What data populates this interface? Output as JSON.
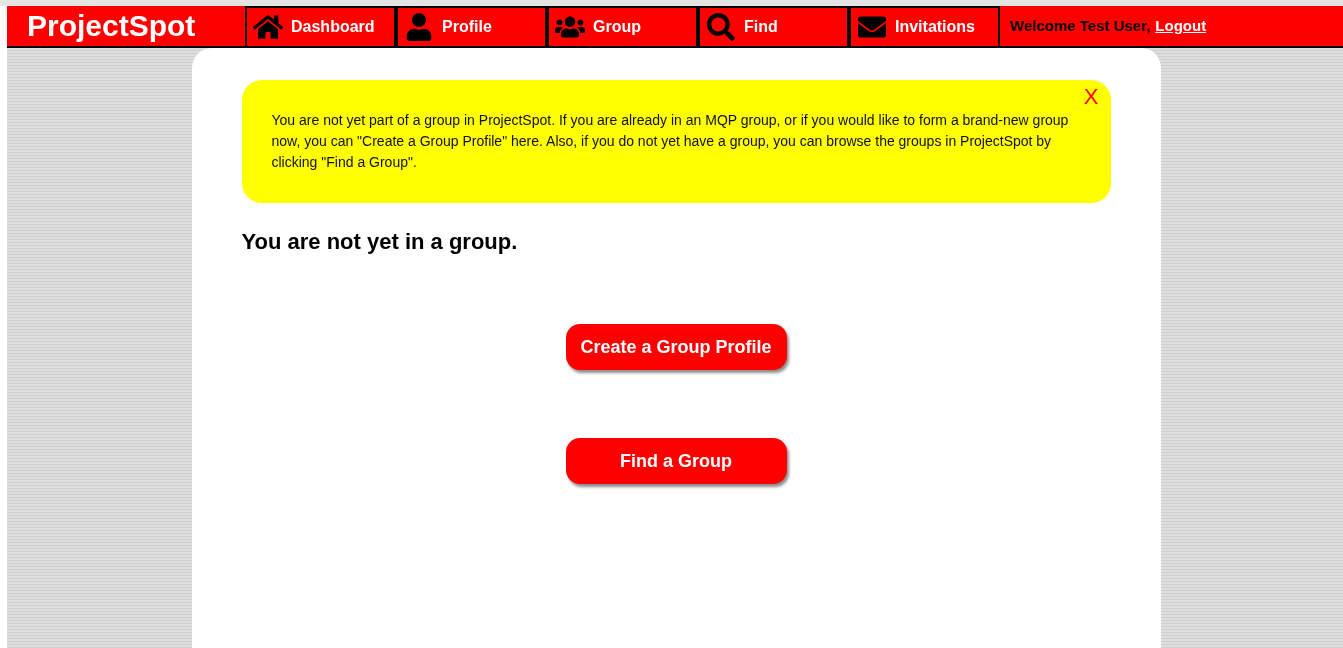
{
  "logo": "ProjectSpot",
  "nav": [
    {
      "kind": "home",
      "label": "Dashboard"
    },
    {
      "kind": "user",
      "label": "Profile"
    },
    {
      "kind": "group",
      "label": "Group"
    },
    {
      "kind": "find",
      "label": "Find"
    },
    {
      "kind": "mail",
      "label": "Invitations"
    }
  ],
  "welcome": {
    "text": "Welcome Test User,",
    "link": "Logout"
  },
  "alert": {
    "text": "You are not yet part of a group in ProjectSpot. If you are already in an MQP group, or if you would like to form a brand-new group now, you can \"Create a Group Profile\" here. Also, if you do not yet have a group, you can browse the groups in ProjectSpot by clicking \"Find a Group\".",
    "close": "X"
  },
  "heading": "You are not yet in a group.",
  "buttons": [
    "Create a Group Profile",
    "Find a Group"
  ]
}
